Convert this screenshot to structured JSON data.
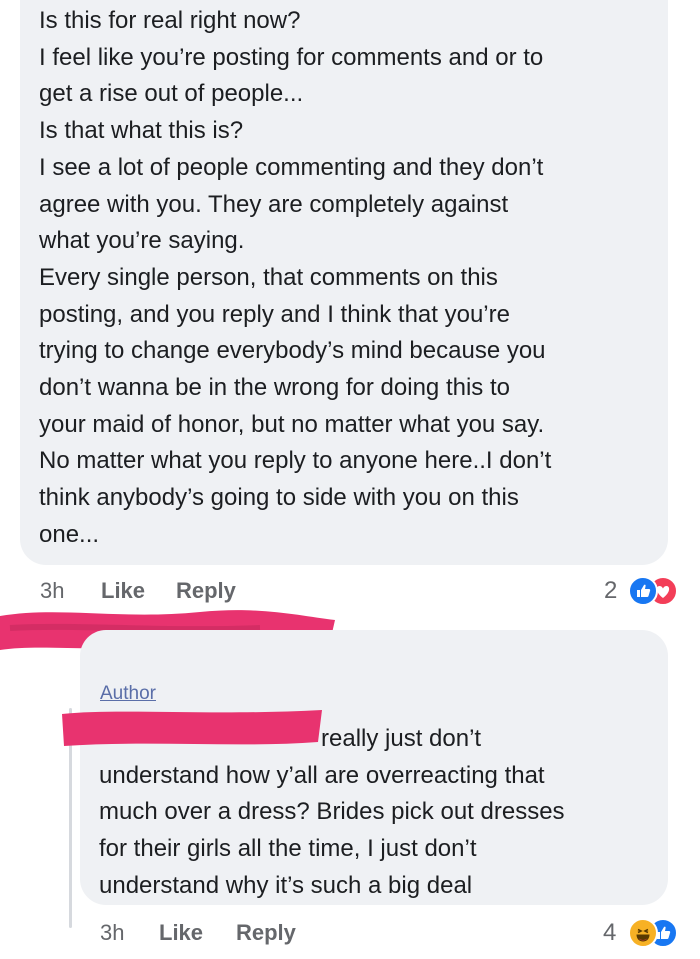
{
  "comments": [
    {
      "body": "Is this for real right now?\nI feel like you’re posting for comments and or to\nget a rise out of people...\nIs that what this is?\nI see a lot of people commenting and they don’t\nagree with you. They are completely against\nwhat you’re saying.\nEvery single person, that comments on this\nposting, and you reply and I think that you’re\ntrying to change everybody’s mind because you\ndon’t wanna be in the wrong for doing this to\nyour maid of honor, but no matter what you say.\nNo matter what you reply to anyone here..I don’t\nthink anybody’s going to side with you on this\none...",
      "time": "3h",
      "like_label": "Like",
      "reply_label": "Reply",
      "reaction_count": "2",
      "reaction_icons": [
        "like-reaction-icon",
        "love-reaction-icon"
      ]
    },
    {
      "badge": "Author",
      "body_first_line": "really just don’t",
      "body_rest": "understand how y’all are overreacting that\nmuch over a dress? Brides pick out dresses\nfor their girls all the time, I just don’t\nunderstand why it’s such a big deal",
      "time": "3h",
      "like_label": "Like",
      "reply_label": "Reply",
      "reaction_count": "4",
      "reaction_icons": [
        "haha-reaction-icon",
        "like-reaction-icon"
      ]
    }
  ],
  "colors": {
    "bubble": "#eff1f4",
    "meta_text": "#65676b",
    "like_blue": "#1877f2",
    "love_red": "#f33e58",
    "haha_yellow": "#f7b125",
    "redaction_pink": "#e8336f"
  }
}
